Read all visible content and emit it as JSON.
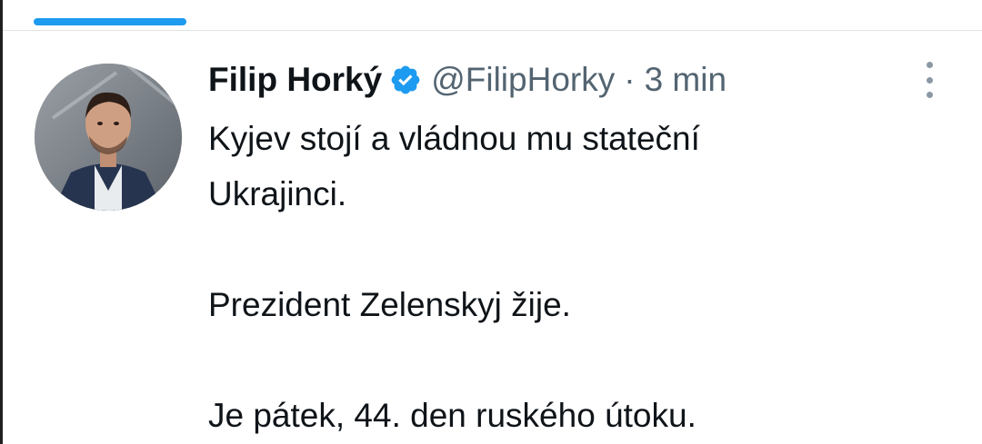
{
  "tweet": {
    "author_name": "Filip Horký",
    "verified": true,
    "handle": "@FilipHorky",
    "separator": "·",
    "timestamp": "3 min",
    "text_lines": [
      "Kyjev stojí a vládnou mu stateční",
      "Ukrajinci.",
      "",
      "Prezident Zelenskyj žije.",
      "",
      "Je pátek, 44. den ruského útoku."
    ]
  },
  "icons": {
    "verified": "verified-badge-icon",
    "more": "more-vertical-icon"
  },
  "colors": {
    "accent": "#1d9bf0",
    "text_primary": "#0f1419",
    "text_secondary": "#536471",
    "divider": "#dfe3e6"
  }
}
